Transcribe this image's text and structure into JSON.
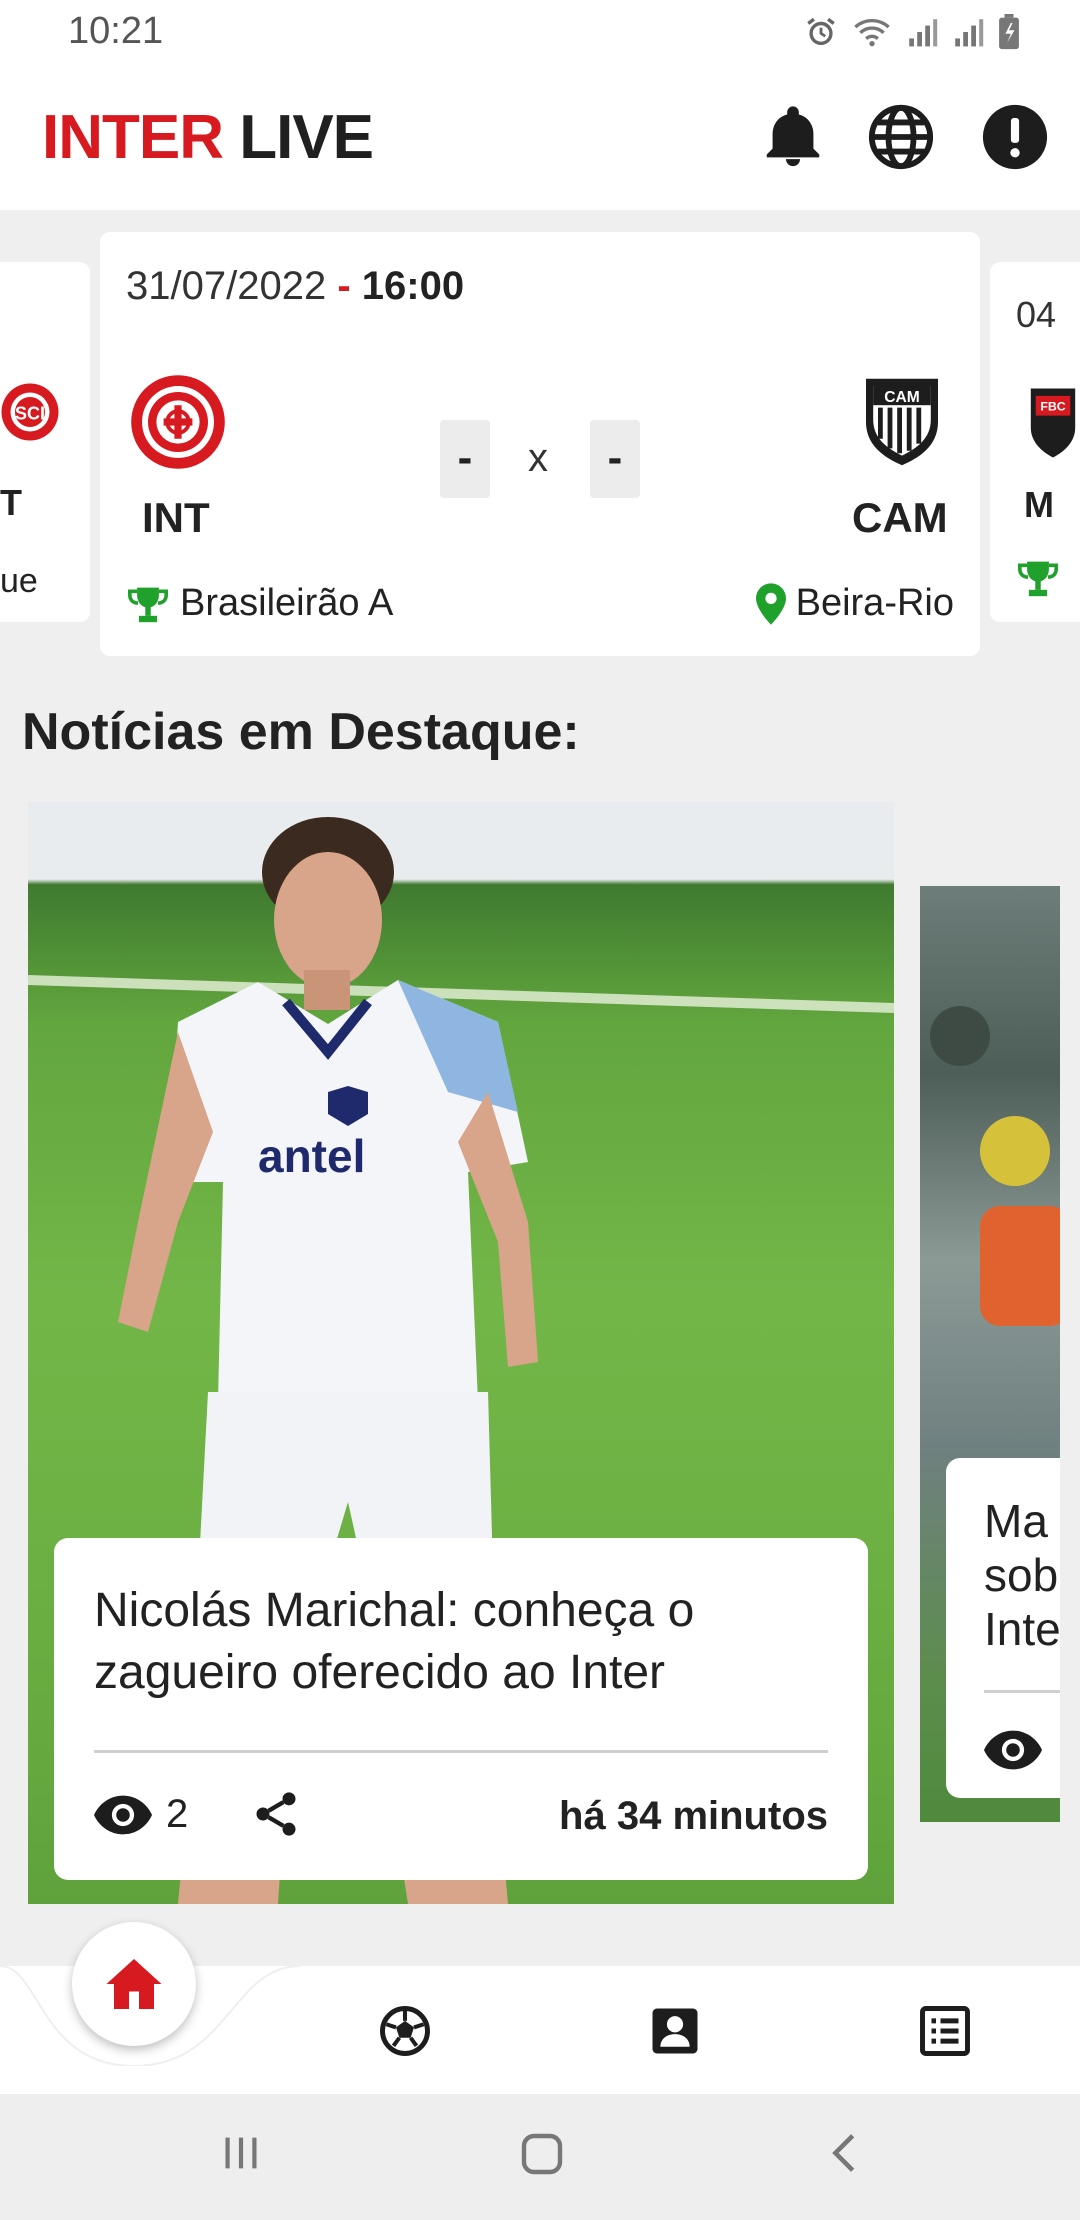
{
  "status_bar": {
    "time": "10:21"
  },
  "app": {
    "logo_part1": "INTER",
    "logo_part2": "LIVE",
    "brand_color": "#d71920",
    "icons": [
      "bell-icon",
      "globe-icon",
      "alert-icon"
    ]
  },
  "matches": {
    "left_peek": {
      "code_fragment": "T",
      "text_fragment": "ue"
    },
    "main": {
      "date": "31/07/2022",
      "separator": "-",
      "time": "16:00",
      "home_code": "INT",
      "away_code": "CAM",
      "home_score": "-",
      "versus": "x",
      "away_score": "-",
      "competition": "Brasileirão A",
      "venue": "Beira-Rio"
    },
    "right_peek": {
      "date_fragment": "04",
      "code_fragment": "M"
    }
  },
  "section": {
    "title": "Notícias em Destaque:"
  },
  "news": [
    {
      "title": "Nicolás Marichal: conheça o zagueiro oferecido ao Inter",
      "views": "2",
      "time_ago": "há 34 minutos"
    },
    {
      "title_fragment": "Ma sob Inte"
    }
  ],
  "bottom_nav": {
    "items": [
      "home-icon",
      "soccer-ball-icon",
      "contact-card-icon",
      "list-icon"
    ],
    "active": "home-icon"
  }
}
